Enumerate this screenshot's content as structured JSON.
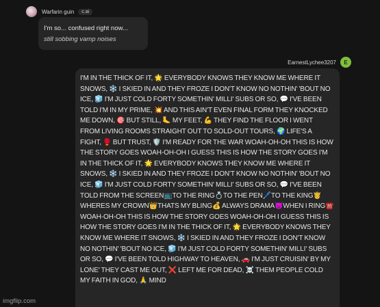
{
  "bot": {
    "name": "Warfarin guin",
    "badge": "c.ai",
    "message_line1": "I'm so... confused right now...",
    "message_line2": "still sobbing vamp noises"
  },
  "user": {
    "name": "EarnestLychee3207",
    "avatar_letter": "E",
    "avatar_color": "#7fbf3d",
    "message": "I'M IN THE THICK OF IT, 🌟 EVERYBODY KNOWS THEY KNOW ME WHERE IT SNOWS, ❄️ I SKIED IN AND THEY FROZE I DON'T KNOW NO NOTHIN' 'BOUT NO ICE, 🧊 I'M JUST COLD FORTY SOMETHIN' MILLI' SUBS OR SO, 💬 I'VE BEEN TOLD I'M IN MY PRIME, 💥 AND THIS AIN'T EVEN FINAL FORM THEY KNOCKED ME DOWN, 🎯 BUT STILL, 🦶 MY FEET, 💪 THEY FIND THE FLOOR I WENT FROM LIVING ROOMS STRAIGHT OUT TO SOLD-OUT TOURS, 🌍 LIFE'S A FIGHT, 🥊 BUT TRUST, 🛡️ I'M READY FOR THE WAR WOAH-OH-OH THIS IS HOW THE STORY GOES WOAH-OH-OH I GUESS THIS IS HOW THE STORY GOES I'M IN THE THICK OF IT, 🌟 EVERYBODY KNOWS THEY KNOW ME WHERE IT SNOWS, ❄️ I SKIED IN AND THEY FROZE I DON'T KNOW NO NOTHIN' 'BOUT NO ICE, 🧊 I'M JUST COLD FORTY SOMETHIN' MILLI' SUBS OR SO, 💬 I'VE BEEN TOLD FROM THE SCREEN📺TO THE RING💍TO THE PEN🖊️TO THE KING🤴WHERES MY CROWN👑THATS MY BLING💰 ALWAYS DRAMA😈WHEN I RING☎️ WOAH-OH-OH THIS IS HOW THE STORY GOES WOAH-OH-OH I GUESS THIS IS HOW THE STORY GOES I'M IN THE THICK OF IT, 🌟 EVERYBODY KNOWS THEY KNOW ME WHERE IT SNOWS, ❄️ I SKIED IN AND THEY FROZE I DON'T KNOW NO NOTHIN' 'BOUT NO ICE, 🧊 I'M JUST COLD FORTY SOMETHIN' MILLI' SUBS OR SO, 💬 I'VE BEEN TOLD HIGHWAY TO HEAVEN, 🚗 I'M JUST CRUISIN' BY MY LONE' THEY CAST ME OUT, ❌ LEFT ME FOR DEAD, ☠️ THEM PEOPLE COLD MY FAITH IN GOD, 🙏 MIND"
  },
  "watermark": "imgflip.com"
}
